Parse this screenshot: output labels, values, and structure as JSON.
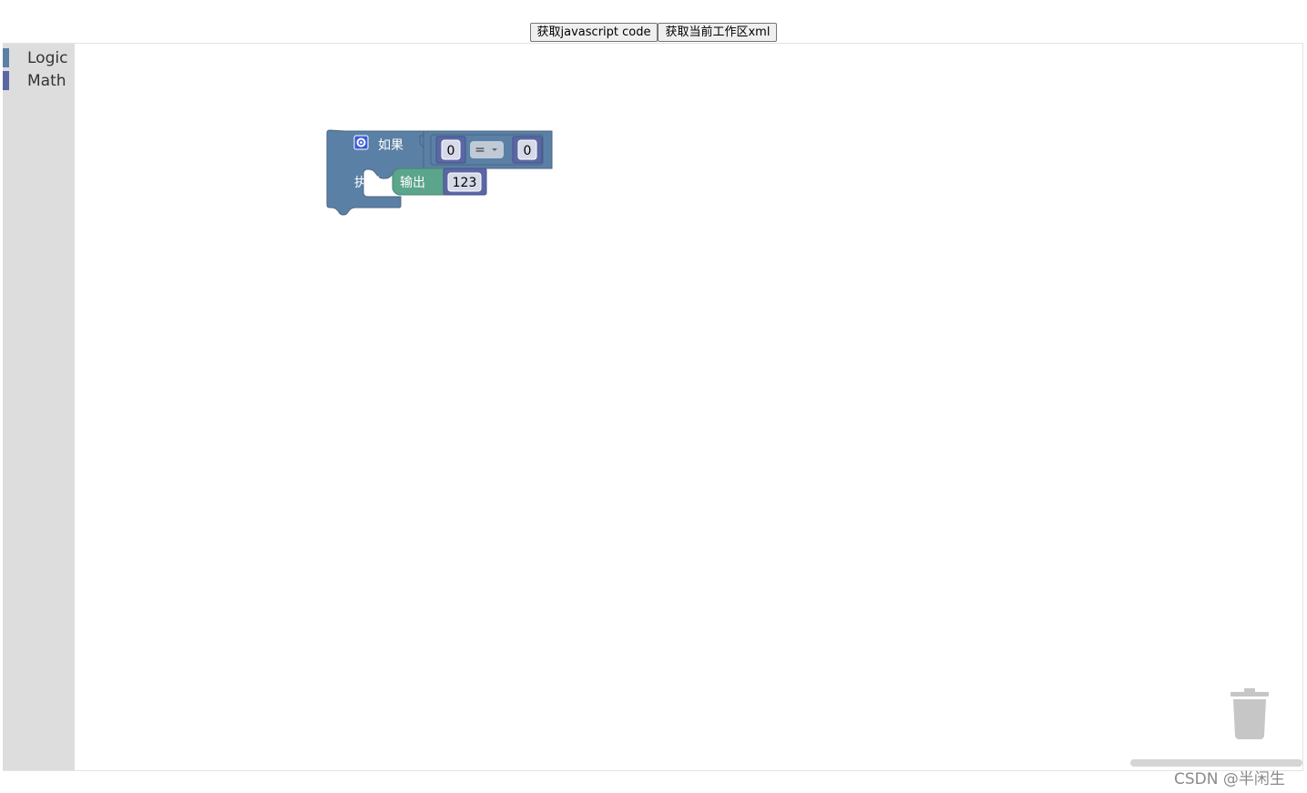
{
  "toolbar": {
    "get_js_label": "获取javascript code",
    "get_xml_label": "获取当前工作区xml"
  },
  "toolbox": {
    "categories": [
      {
        "label": "Logic",
        "color": "#5b80a5"
      },
      {
        "label": "Math",
        "color": "#5b67a5"
      }
    ]
  },
  "workspace": {
    "if_block": {
      "keyword_if": "如果",
      "keyword_do": "执行",
      "color": "#5b80a5",
      "gear_icon": "gear-icon",
      "condition": {
        "left": "0",
        "operator": "=",
        "right": "0",
        "color": "#5b80a5",
        "number_color": "#5b67a5"
      }
    },
    "print_block": {
      "label": "输出",
      "color": "#5ba58c",
      "value": "123",
      "value_color": "#5b67a5"
    }
  },
  "trash": {
    "icon": "trash-icon"
  },
  "watermark": "CSDN @半闲生"
}
